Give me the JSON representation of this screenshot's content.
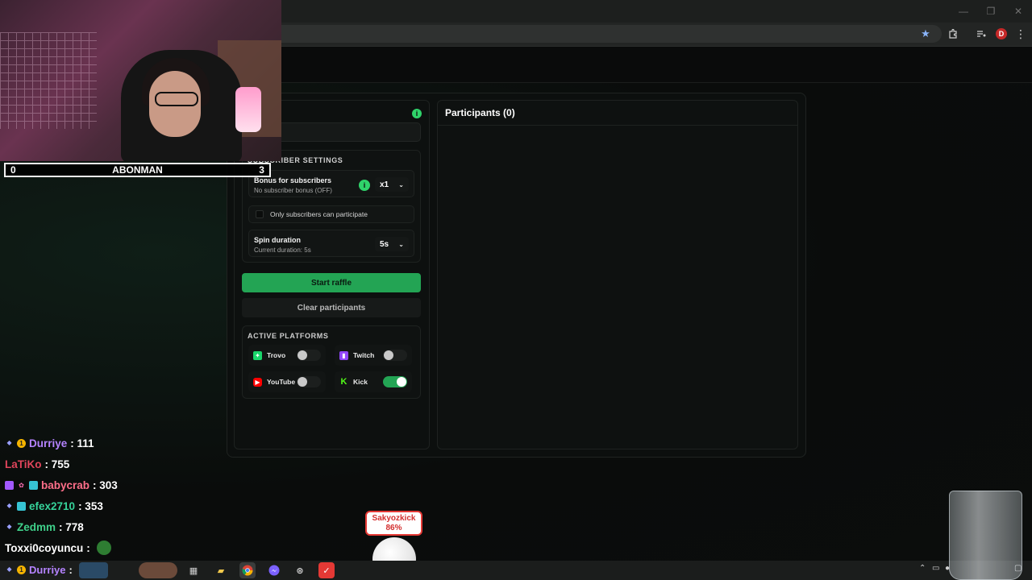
{
  "browser": {
    "window_controls": [
      "—",
      "❐",
      "✕"
    ],
    "toolbar_icons": [
      "bookmark-star-icon",
      "extensions-icon",
      "media-control-icon",
      "profile-avatar",
      "menu-icon"
    ],
    "profile_initial": "D"
  },
  "webcam": {
    "sub_goal": {
      "current": "0",
      "label": "ABONMAN",
      "target": "3"
    }
  },
  "raffle": {
    "participants_title": "Participants (0)",
    "subscriber_settings": {
      "title": "SUBSCRIBER SETTINGS",
      "bonus_title": "Bonus for subscribers",
      "bonus_status": "No subscriber bonus (OFF)",
      "bonus_multiplier": "x1",
      "only_subs_label": "Only subscribers can participate",
      "only_subs_checked": false,
      "spin_title": "Spin duration",
      "spin_current": "Current duration: 5s",
      "spin_value": "5s"
    },
    "start_label": "Start raffle",
    "clear_label": "Clear participants",
    "platforms": {
      "title": "ACTIVE PLATFORMS",
      "items": [
        {
          "name": "Trovo",
          "icon": "trovo-icon",
          "color": "#19d66b",
          "enabled": false
        },
        {
          "name": "Twitch",
          "icon": "twitch-icon",
          "color": "#9146ff",
          "enabled": false
        },
        {
          "name": "YouTube",
          "icon": "youtube-icon",
          "color": "#ff0000",
          "enabled": false
        },
        {
          "name": "Kick",
          "icon": "kick-icon",
          "color": "#53fc18",
          "enabled": true
        }
      ]
    }
  },
  "chat": [
    {
      "name": "Durriye",
      "points": ": 111",
      "color": "#b583ff",
      "badges": [
        "mod-icon",
        "gold-coin-icon"
      ]
    },
    {
      "name": "LaTiKo",
      "points": ": 755",
      "color": "#e0455b",
      "badges": []
    },
    {
      "name": "babycrab",
      "points": ": 303",
      "color": "#ff6f8a",
      "badges": [
        "gem-icon",
        "sparkle-icon",
        "pixel-icon"
      ]
    },
    {
      "name": "efex2710",
      "points": ": 353",
      "color": "#36d39a",
      "badges": [
        "mod-icon",
        "pixel-icon"
      ]
    },
    {
      "name": "Zedmm",
      "points": ": 778",
      "color": "#3fd08a",
      "badges": [
        "mod-icon"
      ]
    },
    {
      "name": "Toxxi0coyuncu",
      "points": ":",
      "color": "#ffffff",
      "badges": []
    },
    {
      "name": "Durriye",
      "points": ":",
      "color": "#b583ff",
      "badges": [
        "mod-icon",
        "gold-coin-icon"
      ]
    }
  ],
  "alert": {
    "name": "Sakyozkick",
    "percent": "86%"
  },
  "colors": {
    "accent_green": "#23a454",
    "alert_red": "#e53935"
  }
}
